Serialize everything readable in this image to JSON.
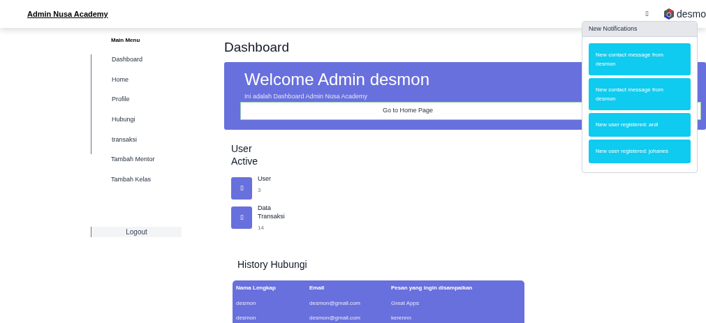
{
  "navbar": {
    "brand": "Admin Nusa Academy",
    "bell": "▯",
    "user": "desmo"
  },
  "sidebar": {
    "heading": "Main Menu",
    "items": [
      "Dashboard",
      "Home",
      "Profile",
      "Hubungi",
      "transaksi",
      "Tambah Mentor",
      "Tambah Kelas"
    ],
    "logout": "Logout"
  },
  "page_title": "Dashboard",
  "welcome": {
    "title": "Welcome Admin desmon",
    "subtitle": "Ini adalah Dashboard Admin Nusa Academy",
    "button": "Go to Home Page"
  },
  "stats": {
    "title": "User Active",
    "items": [
      {
        "icon": "▯",
        "label": "User",
        "value": "3"
      },
      {
        "icon": "▯",
        "label": "Data Transaksi",
        "value": "14"
      }
    ]
  },
  "history": {
    "title": "History Hubungi",
    "columns": [
      "Nama Lengkap",
      "Email",
      "Pesan yang ingin disampaikan"
    ],
    "rows": [
      [
        "desmon",
        "desmon@gmail.com",
        "Great Apps"
      ],
      [
        "desmon",
        "desmon@gmail.com",
        "kerennn"
      ]
    ]
  },
  "notifications": {
    "title": "New Notifications",
    "items": [
      "New contact message from desmon",
      "New contact message from desmon",
      "New user registered: ardi",
      "New user registered: johanes"
    ]
  }
}
